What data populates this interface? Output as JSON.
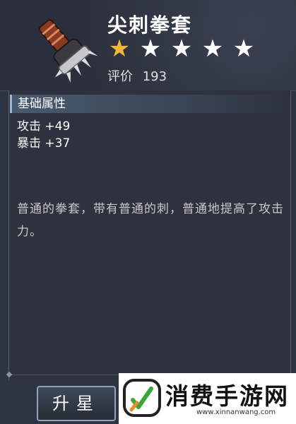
{
  "item": {
    "name": "尖刺拳套",
    "stars_filled": 1,
    "stars_total": 5,
    "rating_label": "评价",
    "rating_value": "193"
  },
  "section": {
    "title": "基础属性",
    "attributes": [
      {
        "text": "攻击 +49"
      },
      {
        "text": "暴击 +37"
      }
    ]
  },
  "description": "普通的拳套，带有普通的刺，普通地提高了攻击力。",
  "buttons": {
    "upgrade_label": "升星"
  },
  "watermark": {
    "text": "消费手游网",
    "url": "www.xinnanwang.com"
  },
  "colors": {
    "star_filled": "#f5b932",
    "star_empty": "#ffffff",
    "watermark_green": "#3aa635",
    "watermark_orange": "#e8892b"
  }
}
